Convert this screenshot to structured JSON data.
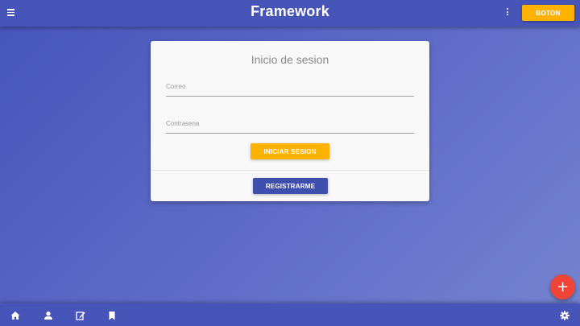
{
  "header": {
    "title": "Framework",
    "action_button": "BOTON",
    "icons": {
      "menu": "menu-icon",
      "more": "more-vert-icon"
    }
  },
  "login_card": {
    "title": "Inicio de sesion",
    "email_label": "Correo",
    "email_value": "",
    "password_label": "Contrasena",
    "password_value": "",
    "login_button": "INICIAR SESION",
    "register_button": "REGISTRARME"
  },
  "fab": {
    "label": "+",
    "icon": "add-icon"
  },
  "bottom_nav": {
    "items": [
      "home-icon",
      "person-icon",
      "edit-icon",
      "bookmark-icon"
    ],
    "settings": "settings-icon"
  },
  "colors": {
    "primary": "#4755b9",
    "accent": "#ffb300",
    "register_button": "#3f4fae",
    "fab": "#f04438",
    "card": "#f8f8f8"
  }
}
